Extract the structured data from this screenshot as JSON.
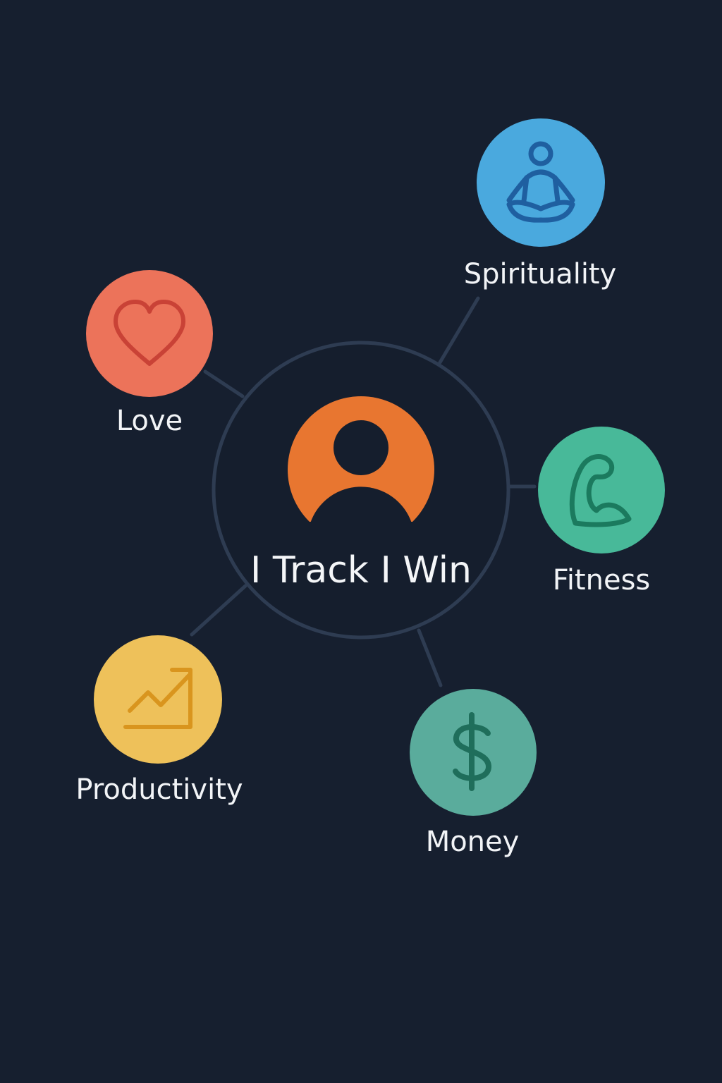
{
  "hub": {
    "title": "I Track I Win",
    "icon": "user-avatar-icon",
    "color": "#e87630"
  },
  "nodes": [
    {
      "id": "spirituality",
      "label": "Spirituality",
      "icon": "meditation-icon",
      "color": "#4aa9de",
      "icon_color": "#1f5fa0"
    },
    {
      "id": "love",
      "label": "Love",
      "icon": "heart-icon",
      "color": "#ec735a",
      "icon_color": "#c94236"
    },
    {
      "id": "fitness",
      "label": "Fitness",
      "icon": "flexed-arm-icon",
      "color": "#48b999",
      "icon_color": "#1b7a5e"
    },
    {
      "id": "productivity",
      "label": "Productivity",
      "icon": "trend-chart-icon",
      "color": "#eec15a",
      "icon_color": "#d9951e"
    },
    {
      "id": "money",
      "label": "Money",
      "icon": "dollar-icon",
      "color": "#5aac9c",
      "icon_color": "#1f6e5b"
    }
  ],
  "colors": {
    "background": "#161f2f",
    "connector": "#2e3c52",
    "text": "#f2f4f7"
  }
}
